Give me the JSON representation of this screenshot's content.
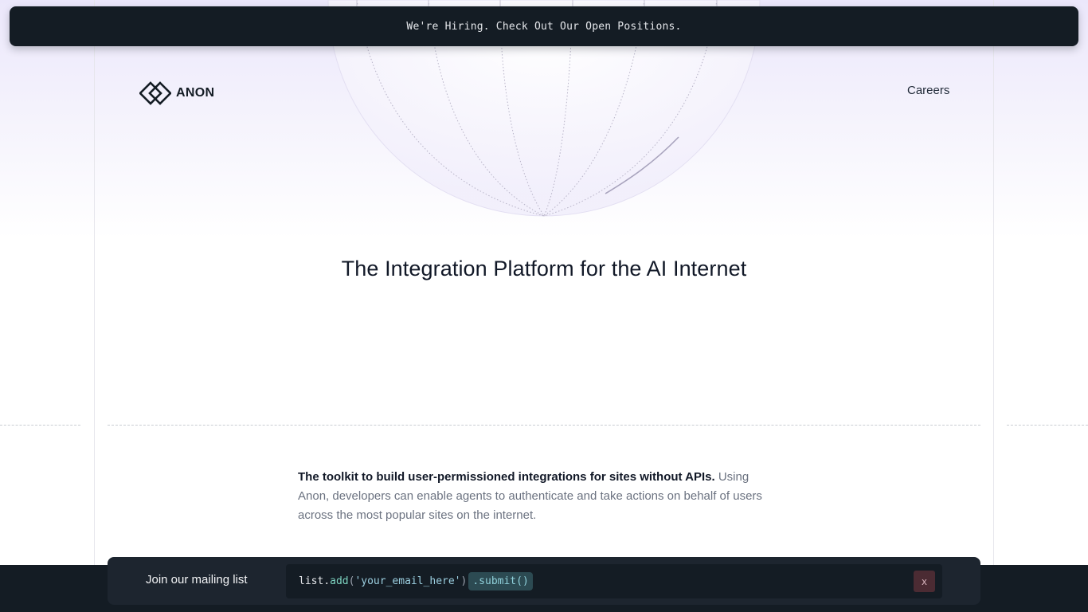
{
  "announcement": {
    "text": "We're Hiring. Check Out Our Open Positions."
  },
  "header": {
    "logo_text": "ANON",
    "nav": {
      "careers_label": "Careers"
    }
  },
  "hero": {
    "title": "The Integration Platform for the AI Internet"
  },
  "intro": {
    "lead": "The toolkit to build user-permissioned integrations for sites without APIs.",
    "body": " Using Anon, developers can enable agents to authenticate and take actions on behalf of users across the most popular sites on the internet."
  },
  "mailing_list": {
    "label": "Join our mailing list",
    "code_object": "list",
    "code_method": "add",
    "code_placeholder": "'your_email_here'",
    "submit_label": ".submit()",
    "close_label": "x"
  },
  "colors": {
    "dark_bar": "#141c24",
    "hero_tint": "#ebe7fb",
    "submit_accent": "#2c4a52",
    "close_accent": "#4b2b33"
  },
  "icons": {
    "logo": "diamond-chain-icon",
    "globe": "globe-graphic"
  }
}
